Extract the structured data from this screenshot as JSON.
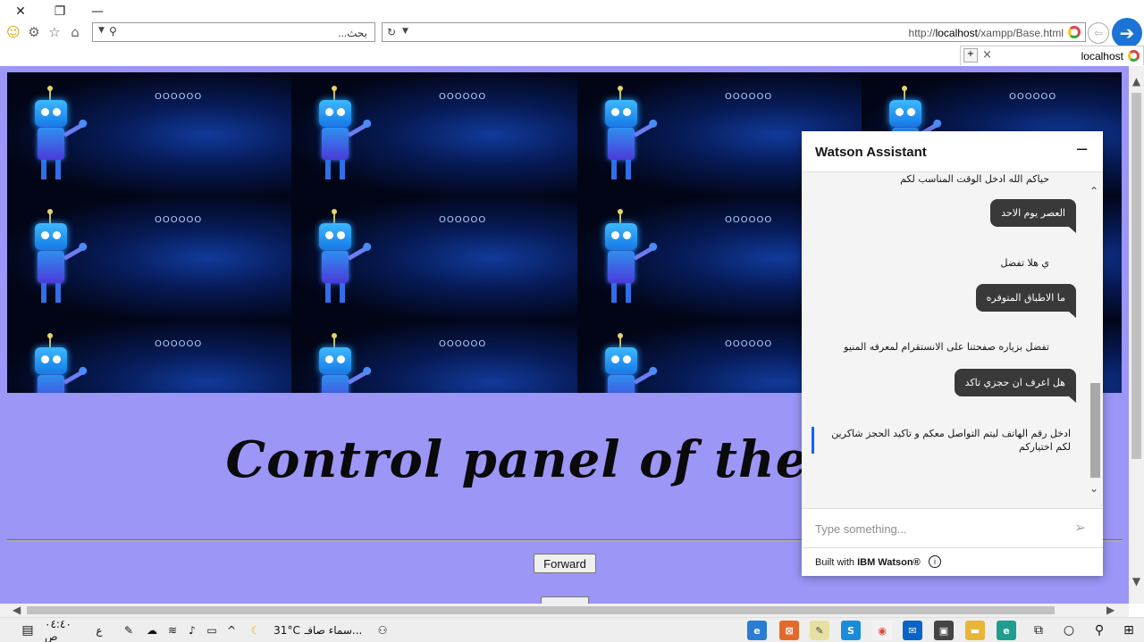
{
  "window": {
    "close_icon": "close-icon",
    "restore_icon": "restore-icon",
    "minimize_icon": "minimize-icon"
  },
  "toolbar": {
    "icons": [
      "smiley-icon",
      "gear-icon",
      "star-icon",
      "home-icon"
    ],
    "search_placeholder": "...بحث",
    "url_prefix": "http://",
    "url_host": "localhost",
    "url_path": "/xampp/Base.html",
    "back_icon": "back-icon",
    "forward_icon": "forward-arrow-icon"
  },
  "tab": {
    "title": "localhost",
    "close_label": "×"
  },
  "page": {
    "heading": "Control panel of the Ba",
    "forward_button": "Forward",
    "banner_rings": [
      "OOOOOO",
      "OOOOOO",
      "OOOOOO",
      "OOOOOO",
      "OOOOOO",
      "OOOOOO",
      "OOOOOO",
      "OOOOOO",
      "OOOOOO",
      "OOOOOO",
      "OOOOOO",
      "OOOOOO"
    ],
    "background_color": "#9c96f7"
  },
  "watson": {
    "title": "Watson Assistant",
    "minimize_label": "−",
    "messages": [
      {
        "from": "bot",
        "text": "حياكم الله ادخل الوقت المناسب لكم"
      },
      {
        "from": "user",
        "text": "العصر يوم الاحد"
      },
      {
        "from": "bot",
        "text": "ي هلا تفضل"
      },
      {
        "from": "user",
        "text": "ما الاطباق المتوفره"
      },
      {
        "from": "bot",
        "text": "تفضل بزياره صفحتنا على الانستقرام لمعرفه المنيو"
      },
      {
        "from": "user",
        "text": "هل اعرف ان حجزي تاكد"
      }
    ],
    "last_message": "ادخل رقم الهاتف ليتم التواصل معكم و تاكيد الحجز شاكرين لكم اختياركم",
    "help_label": "?",
    "input_placeholder": "Type something...",
    "footer_prefix": "Built with ",
    "footer_brand": "IBM Watson®",
    "info_label": "i",
    "accent_color": "#0f62fe"
  },
  "taskbar": {
    "time": "٠٤:٤٠ ص",
    "lang": "ع",
    "weather_text": "سماء صافـ...",
    "temperature": "31°C"
  }
}
